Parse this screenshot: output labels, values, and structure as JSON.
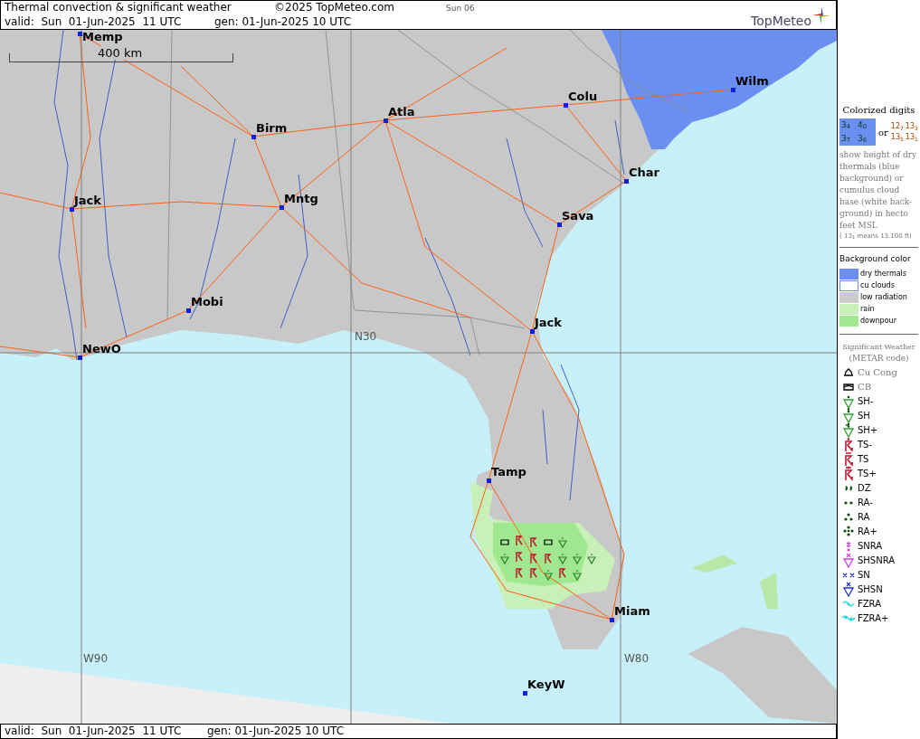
{
  "header": {
    "title": "Thermal convection & significant weather",
    "copyright": "©2025 TopMeteo.com",
    "day": "Sun 06",
    "valid": "valid:  Sun  01-Jun-2025  11 UTC",
    "generated": "gen: 01-Jun-2025 10 UTC",
    "logo": "TopMeteo"
  },
  "map": {
    "scale": "400 km",
    "grid_labels": [
      "N30",
      "W90",
      "W80"
    ],
    "cities": [
      {
        "name": "Memp"
      },
      {
        "name": "Birm"
      },
      {
        "name": "Atla"
      },
      {
        "name": "Colu"
      },
      {
        "name": "Wilm"
      },
      {
        "name": "Char"
      },
      {
        "name": "Jack"
      },
      {
        "name": "Mntg"
      },
      {
        "name": "Sava"
      },
      {
        "name": "Mobi"
      },
      {
        "name": "NewO"
      },
      {
        "name": "Jack"
      },
      {
        "name": "Tamp"
      },
      {
        "name": "Miam"
      },
      {
        "name": "KeyW"
      }
    ]
  },
  "legend": {
    "colorized": {
      "title": "Colorized digits",
      "thermal_digits": [
        "3$_{4}$",
        "4$_{0}$",
        "3$_{7}$",
        "3$_{6}$"
      ],
      "or": "or",
      "cloud_digits": [
        "12$_{7}$",
        "13$_{3}$",
        "13$_{5}$",
        "13$_{1}$"
      ],
      "description": "show height of dry thermals (blue background) or cumulus cloud base (white back-ground) in hecto feet MSL",
      "example": "( 13$_{1}$ means 13.100 ft)"
    },
    "background": {
      "title": "Background color",
      "items": [
        {
          "label": "dry thermals",
          "color": "#6b8ff0",
          "kind": "filled"
        },
        {
          "label": "cu clouds",
          "color": "#ffffff",
          "kind": "outlined"
        },
        {
          "label": "low radiation",
          "color": "#cccccc",
          "kind": "filled"
        },
        {
          "label": "rain",
          "color": "#c8f0b8",
          "kind": "filled"
        },
        {
          "label": "downpour",
          "color": "#a0e890",
          "kind": "filled"
        }
      ]
    },
    "weather": {
      "title": "Significant Weather",
      "subtitle": "(METAR code)",
      "items": [
        {
          "kind": "cu_cong",
          "label": "Cu Cong"
        },
        {
          "kind": "cb",
          "label": "CB"
        },
        {
          "kind": "sh_light",
          "label": "SH-"
        },
        {
          "kind": "sh",
          "label": "SH"
        },
        {
          "kind": "sh_heavy",
          "label": "SH+"
        },
        {
          "kind": "ts_light",
          "label": "TS-"
        },
        {
          "kind": "ts",
          "label": "TS"
        },
        {
          "kind": "ts_heavy",
          "label": "TS+"
        },
        {
          "kind": "dz",
          "label": "DZ"
        },
        {
          "kind": "ra_light",
          "label": "RA-"
        },
        {
          "kind": "ra",
          "label": "RA"
        },
        {
          "kind": "ra_heavy",
          "label": "RA+"
        },
        {
          "kind": "snra",
          "label": "SNRA"
        },
        {
          "kind": "shsnra",
          "label": "SHSNRA"
        },
        {
          "kind": "sn",
          "label": "SN"
        },
        {
          "kind": "shsn",
          "label": "SHSN"
        },
        {
          "kind": "fzra",
          "label": "FZRA"
        },
        {
          "kind": "fzra_heavy",
          "label": "FZRA+"
        }
      ]
    }
  },
  "footer": {
    "valid": "valid:  Sun  01-Jun-2025  11 UTC",
    "generated": "gen: 01-Jun-2025 10 UTC"
  }
}
